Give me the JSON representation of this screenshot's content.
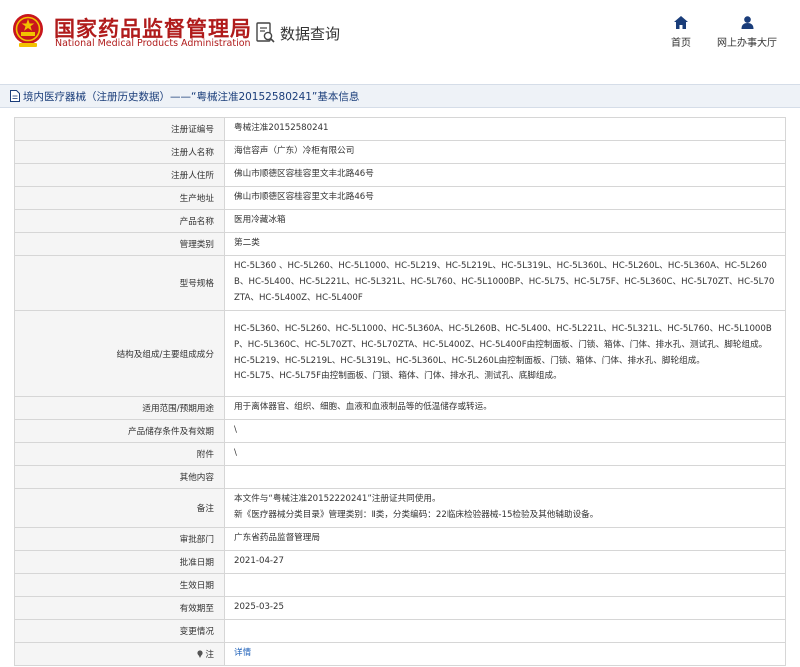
{
  "header": {
    "logo_cn": "国家药品监督管理局",
    "logo_en": "National Medical Products Administration",
    "query_label": "数据查询",
    "nav": [
      {
        "label": "首页",
        "icon": "home-icon"
      },
      {
        "label": "网上办事大厅",
        "icon": "user-icon"
      }
    ]
  },
  "title_bar": {
    "text": "境内医疗器械（注册历史数据）——“粤械注准20152580241”基本信息"
  },
  "rows": [
    {
      "label": "注册证编号",
      "value": "粤械注准20152580241"
    },
    {
      "label": "注册人名称",
      "value": "海信容声（广东）冷柜有限公司"
    },
    {
      "label": "注册人住所",
      "value": "佛山市顺德区容桂容里文丰北路46号"
    },
    {
      "label": "生产地址",
      "value": "佛山市顺德区容桂容里文丰北路46号"
    },
    {
      "label": "产品名称",
      "value": "医用冷藏冰箱"
    },
    {
      "label": "管理类别",
      "value": "第二类"
    },
    {
      "label": "型号规格",
      "value": "HC-5L360 、HC-5L260、HC-5L1000、HC-5L219、HC-5L219L、HC-5L319L、HC-5L360L、HC-5L260L、HC-5L360A、HC-5L260B、HC-5L400、HC-5L221L、HC-5L321L、HC-5L760、HC-5L1000BP、HC-5L75、HC-5L75F、HC-5L360C、HC-5L70ZT、HC-5L70ZTA、HC-5L400Z、HC-5L400F"
    },
    {
      "label": "结构及组成/主要组成成分",
      "lines": [
        "HC-5L360、HC-5L260、HC-5L1000、HC-5L360A、HC-5L260B、HC-5L400、HC-5L221L、HC-5L321L、HC-5L760、HC-5L1000BP、HC-5L360C、HC-5L70ZT、HC-5L70ZTA、HC-5L400Z、HC-5L400F由控制面板、门锁、箱体、门体、排水孔、测试孔、脚轮组成。",
        "HC-5L219、HC-5L219L、HC-5L319L、HC-5L360L、HC-5L260L由控制面板、门锁、箱体、门体、排水孔、脚轮组成。",
        "HC-5L75、HC-5L75F由控制面板、门锁、箱体、门体、排水孔、测试孔、底脚组成。"
      ]
    },
    {
      "label": "适用范围/预期用途",
      "value": "用于离体器官、组织、细胞、血液和血液制品等的低温储存或转运。"
    },
    {
      "label": "产品储存条件及有效期",
      "value": "\\"
    },
    {
      "label": "附件",
      "value": "\\"
    },
    {
      "label": "其他内容",
      "value": ""
    },
    {
      "label": "备注",
      "lines": [
        "本文件与“粤械注准20152220241”注册证共同使用。",
        "新《医疗器械分类目录》管理类别：Ⅱ类，分类编码：22临床检验器械-15检验及其他辅助设备。"
      ]
    },
    {
      "label": "审批部门",
      "value": "广东省药品监督管理局"
    },
    {
      "label": "批准日期",
      "value": "2021-04-27"
    },
    {
      "label": "生效日期",
      "value": ""
    },
    {
      "label": "有效期至",
      "value": "2025-03-25"
    },
    {
      "label": "变更情况",
      "value": ""
    },
    {
      "label": "注",
      "value": "详情",
      "link": true
    }
  ],
  "colors": {
    "brand_red": "#b01b1b",
    "nav_blue": "#1a3d7a",
    "link_blue": "#1c5fb8",
    "label_bg": "#f5f5f5",
    "border": "#d6d6d6"
  }
}
